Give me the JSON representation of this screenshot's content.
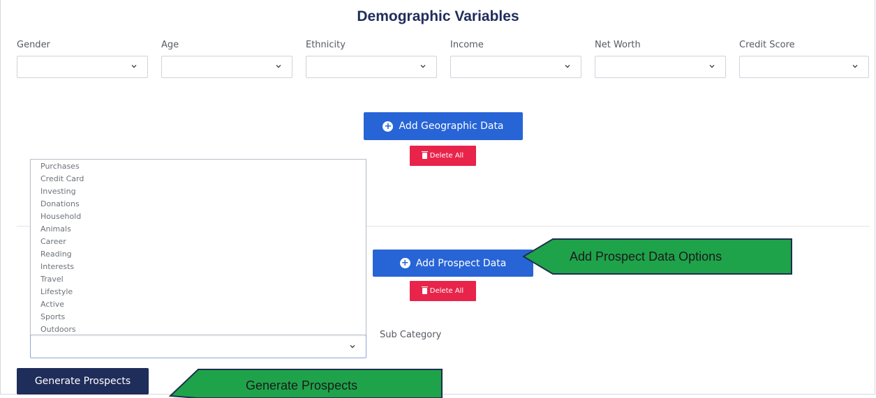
{
  "title": "Demographic Variables",
  "demographics": [
    {
      "label": "Gender",
      "value": ""
    },
    {
      "label": "Age",
      "value": ""
    },
    {
      "label": "Ethnicity",
      "value": ""
    },
    {
      "label": "Income",
      "value": ""
    },
    {
      "label": "Net Worth",
      "value": ""
    },
    {
      "label": "Credit Score",
      "value": ""
    }
  ],
  "geographic": {
    "add_label": "Add Geographic Data",
    "delete_label": "Delete All"
  },
  "prospect": {
    "add_label": "Add Prospect Data",
    "delete_label": "Delete All",
    "category_options": [
      "Purchases",
      "Credit Card",
      "Investing",
      "Donations",
      "Household",
      "Animals",
      "Career",
      "Reading",
      "Interests",
      "Travel",
      "Lifestyle",
      "Active",
      "Sports",
      "Outdoors"
    ],
    "category_value": "",
    "sub_category_label": "Sub Category"
  },
  "generate_button": "Generate Prospects",
  "callouts": {
    "prospect_options": "Add Prospect Data Options",
    "generate": "Generate Prospects"
  },
  "colors": {
    "primary": "#2764d6",
    "danger": "#e8244a",
    "navy": "#1f2d5a",
    "callout_fill": "#1fa34a",
    "callout_border": "#1d2f4d"
  }
}
